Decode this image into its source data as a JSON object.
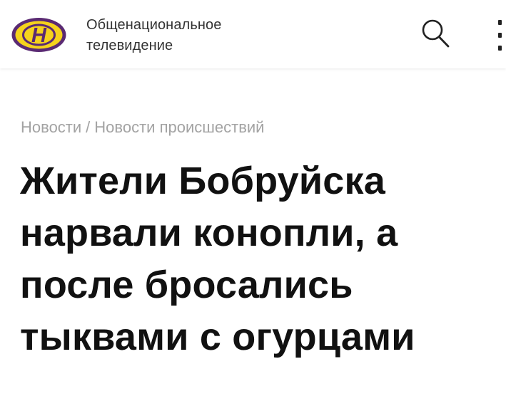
{
  "header": {
    "brand_line1": "Общенациональное",
    "brand_line2": "телевидение",
    "logo_letter": "Н",
    "colors": {
      "logo_yellow": "#f5d31c",
      "logo_purple": "#5a2a73"
    },
    "icons": [
      "logo-icon",
      "search-icon",
      "kebab-menu-icon"
    ]
  },
  "breadcrumb": {
    "items": [
      {
        "label": "Новости"
      },
      {
        "label": "Новости происшествий"
      }
    ],
    "separator": "/"
  },
  "article": {
    "headline_lines": [
      "Жители Бобруйска",
      "нарвали конопли, а",
      "после бросались",
      "тыквами с огурцами"
    ]
  }
}
